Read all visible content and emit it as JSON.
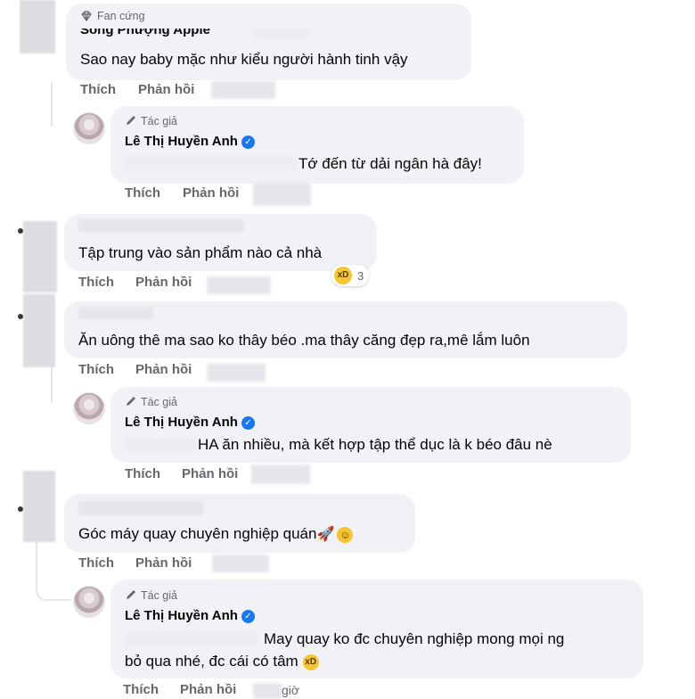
{
  "comments": [
    {
      "badge": "Fan cứng",
      "author_partial": "Song Phượng Apple",
      "text": "Sao nay baby mặc như kiểu người hành tinh vậy",
      "actions": {
        "like": "Thích",
        "reply": "Phản hồi"
      }
    },
    {
      "badge": "Tác giả",
      "author": "Lê Thị Huyền Anh",
      "text": "Tớ đến từ dải ngân hà đây!",
      "actions": {
        "like": "Thích",
        "reply": "Phản hồi"
      }
    },
    {
      "text": "Tập trung vào sản phẩm nào cả nhà",
      "reaction_count": "3",
      "actions": {
        "like": "Thích",
        "reply": "Phản hồi"
      }
    },
    {
      "text": "Ăn uông thê ma sao ko thây béo .ma thây căng đẹp ra,mê lắm luôn",
      "actions": {
        "like": "Thích",
        "reply": "Phản hồi"
      }
    },
    {
      "badge": "Tác giả",
      "author": "Lê Thị Huyền Anh",
      "text": "HA ăn nhiều, mà kết hợp tập thể dục là k béo đâu nè",
      "actions": {
        "like": "Thích",
        "reply": "Phản hồi"
      }
    },
    {
      "text": "Góc máy quay chuyên nghiệp quán",
      "emoji_1": "🚀",
      "emoji_2": "☺",
      "actions": {
        "like": "Thích",
        "reply": "Phản hồi"
      }
    },
    {
      "badge": "Tác giả",
      "author": "Lê Thị Huyền Anh",
      "text_line1": "May quay ko đc chuyên nghiệp mong mọi ng",
      "text_line2": "bỏ qua nhé, đc cái có tâm",
      "timestamp_partial": "giờ",
      "actions": {
        "like": "Thích",
        "reply": "Phản hồi"
      }
    }
  ],
  "icons": {
    "fan_badge": "diamond-icon",
    "author_badge": "pencil-icon",
    "verified": "verified-check-icon",
    "reaction": "laughing-emoji-icon",
    "grin": "grin-emoji-icon"
  },
  "colors": {
    "bubble": "#f0f2f5",
    "meta": "#65676b",
    "verified": "#1877f2"
  }
}
